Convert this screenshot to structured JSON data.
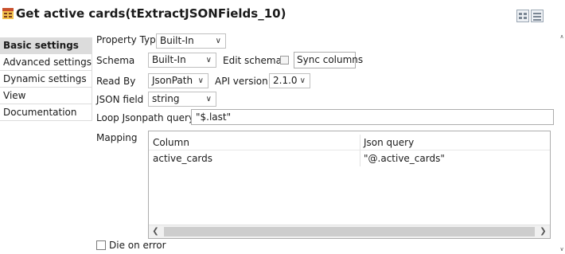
{
  "title": "Get active cards(tExtractJSONFields_10)",
  "sidebar": {
    "items": [
      {
        "label": "Basic settings"
      },
      {
        "label": "Advanced settings"
      },
      {
        "label": "Dynamic settings"
      },
      {
        "label": "View"
      },
      {
        "label": "Documentation"
      }
    ]
  },
  "form": {
    "property_type_label": "Property Type",
    "property_type_value": "Built-In",
    "schema_label": "Schema",
    "schema_value": "Built-In",
    "edit_schema_label": "Edit schema",
    "sync_columns_label": "Sync columns",
    "read_by_label": "Read By",
    "read_by_value": "JsonPath",
    "api_version_label": "API version",
    "api_version_value": "2.1.0",
    "json_field_label": "JSON field",
    "json_field_value": "string",
    "loop_query_label": "Loop Jsonpath query",
    "loop_query_value": "\"$.last\"",
    "mapping_label": "Mapping",
    "die_on_error_label": "Die on error"
  },
  "mapping": {
    "columns": [
      "Column",
      "Json query"
    ],
    "rows": [
      [
        "active_cards",
        "\"@.active_cards\""
      ]
    ]
  },
  "icons": {
    "component": "component-icon",
    "dropdown": "chevron-down-icon",
    "scroll_left": "arrow-left-icon",
    "scroll_right": "arrow-right-icon",
    "scroll_up": "arrow-up-icon",
    "scroll_down": "arrow-down-icon"
  },
  "colors": {
    "active_tab_bg": "#dcdcdc",
    "border": "#adadad",
    "component_icon": "#c9502d"
  }
}
